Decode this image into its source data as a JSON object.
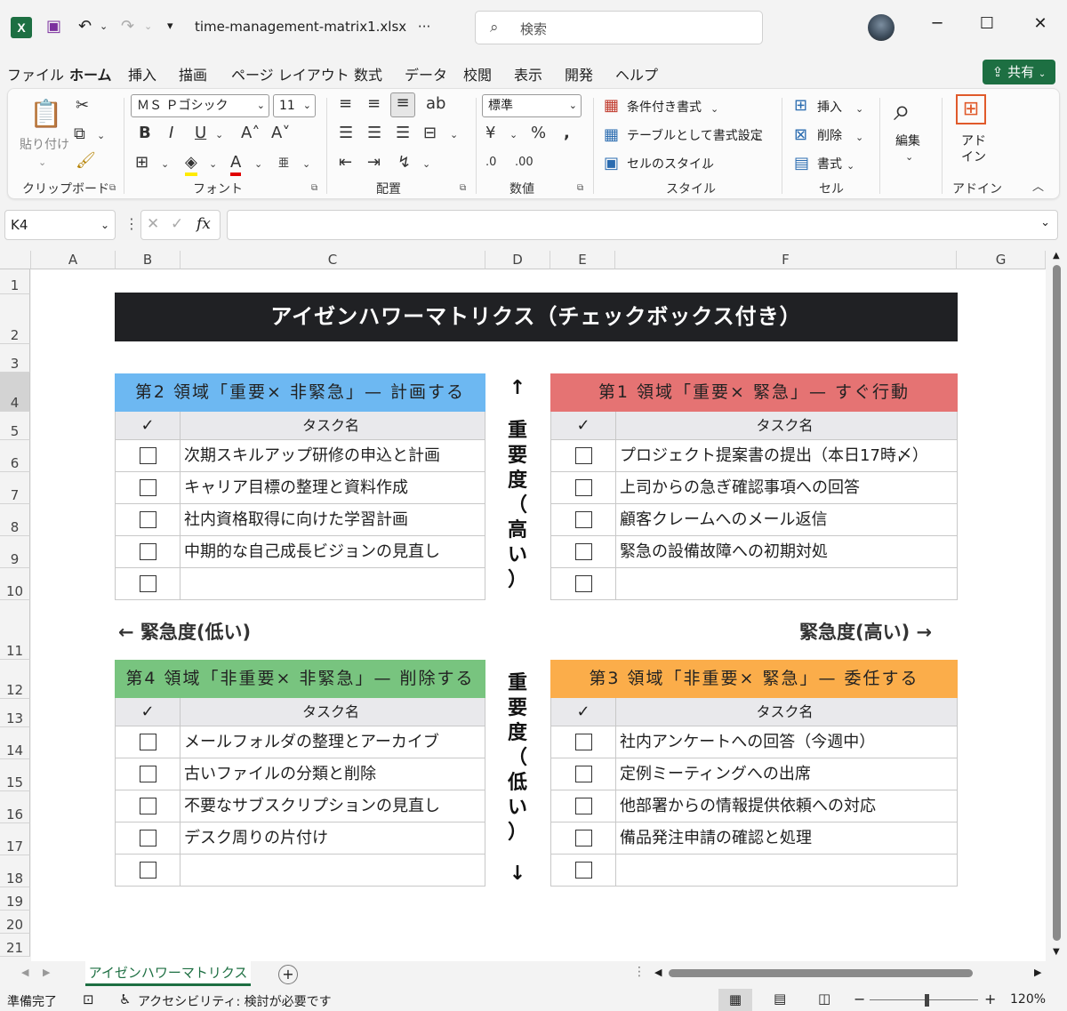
{
  "window": {
    "filename": "time-management-matrix1.xlsx",
    "filename_suffix": "···",
    "search_placeholder": "検索",
    "logo": "X"
  },
  "menu": [
    "ファイル",
    "ホーム",
    "挿入",
    "描画",
    "ページ レイアウト",
    "数式",
    "データ",
    "校閲",
    "表示",
    "開発",
    "ヘルプ"
  ],
  "share_label": "共有",
  "ribbon": {
    "clipboard": {
      "paste": "貼り付け",
      "label": "クリップボード"
    },
    "font": {
      "name": "ＭＳ Ｐゴシック",
      "size": "11",
      "label": "フォント"
    },
    "alignment": {
      "label": "配置"
    },
    "number": {
      "format": "標準",
      "label": "数値"
    },
    "styles": {
      "conditional": "条件付き書式",
      "table": "テーブルとして書式設定",
      "cell": "セルのスタイル",
      "label": "スタイル"
    },
    "cells": {
      "insert": "挿入",
      "delete": "削除",
      "format": "書式",
      "label": "セル"
    },
    "editing": {
      "label": "編集"
    },
    "addin": {
      "line1": "アド",
      "line2": "イン",
      "label": "アドイン"
    }
  },
  "namebox": "K4",
  "fx": "fx",
  "columns": [
    "A",
    "B",
    "C",
    "D",
    "E",
    "F",
    "G"
  ],
  "rows": [
    "1",
    "2",
    "3",
    "4",
    "5",
    "6",
    "7",
    "8",
    "9",
    "10",
    "11",
    "12",
    "13",
    "14",
    "15",
    "16",
    "17",
    "18",
    "19",
    "20",
    "21"
  ],
  "sheet": {
    "title": "アイゼンハワーマトリクス（チェックボックス付き）",
    "check_header": "✓",
    "task_header": "タスク名",
    "quadrants": {
      "q2": {
        "title": "第2 領域「重要× 非緊急」— 計画する",
        "color": "#6db8f2",
        "tasks": [
          "次期スキルアップ研修の申込と計画",
          "キャリア目標の整理と資料作成",
          "社内資格取得に向けた学習計画",
          "中期的な自己成長ビジョンの見直し",
          ""
        ]
      },
      "q1": {
        "title": "第1 領域「重要× 緊急」— すぐ行動",
        "color": "#e57373",
        "tasks": [
          "プロジェクト提案書の提出（本日17時〆）",
          "上司からの急ぎ確認事項への回答",
          "顧客クレームへのメール返信",
          "緊急の設備故障への初期対処",
          ""
        ]
      },
      "q4": {
        "title": "第4 領域「非重要× 非緊急」— 削除する",
        "color": "#78c47f",
        "tasks": [
          "メールフォルダの整理とアーカイブ",
          "古いファイルの分類と削除",
          "不要なサブスクリプションの見直し",
          "デスク周りの片付け",
          ""
        ]
      },
      "q3": {
        "title": "第3 領域「非重要× 緊急」— 委任する",
        "color": "#fbad4a",
        "tasks": [
          "社内アンケートへの回答（今週中）",
          "定例ミーティングへの出席",
          "他部署からの情報提供依頼への対応",
          "備品発注申請の確認と処理",
          ""
        ]
      }
    },
    "up_arrow": "↑",
    "down_arrow": "↓",
    "vert_high": [
      "重",
      "要",
      "度",
      "（",
      "高",
      "い",
      "）"
    ],
    "vert_low": [
      "重",
      "要",
      "度",
      "（",
      "低",
      "い",
      "）"
    ],
    "urgency_low": "← 緊急度(低い)",
    "urgency_high": "緊急度(高い) →"
  },
  "sheet_tab": "アイゼンハワーマトリクス",
  "status": {
    "ready": "準備完了",
    "accessibility": "アクセシビリティ: 検討が必要です",
    "zoom": "120%"
  }
}
